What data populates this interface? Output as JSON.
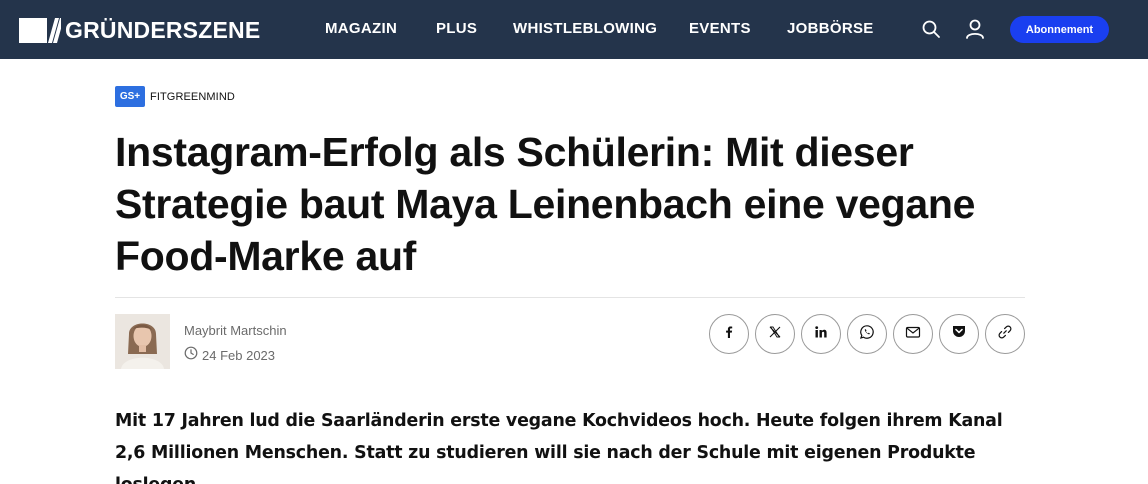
{
  "header": {
    "logo_text": "GRÜNDERSZENE",
    "nav": [
      "MAGAZIN",
      "PLUS",
      "WHISTLEBLOWING",
      "EVENTS",
      "JOBBÖRSE"
    ],
    "subscribe_label": "Abonnement",
    "background_color": "#24344b",
    "accent_color": "#1a3ff0",
    "icons": [
      "search-icon",
      "user-icon"
    ]
  },
  "article": {
    "badge": "GS+",
    "kicker": "FITGREENMIND",
    "headline": "Instagram-Erfolg als Schülerin: Mit dieser Strategie baut Maya Leinenbach eine vegane Food-Marke auf",
    "author": "Maybrit Martschin",
    "date": "24 Feb 2023",
    "lead": "Mit 17 Jahren lud die Saarländerin erste vegane Kochvideos hoch. Heute folgen ihrem Kanal 2,6 Millionen Menschen. Statt zu studieren will sie nach der Schule mit eigenen Produkte loslegen."
  },
  "share": [
    "facebook-icon",
    "x-icon",
    "linkedin-icon",
    "whatsapp-icon",
    "mail-icon",
    "pocket-icon",
    "link-icon"
  ]
}
